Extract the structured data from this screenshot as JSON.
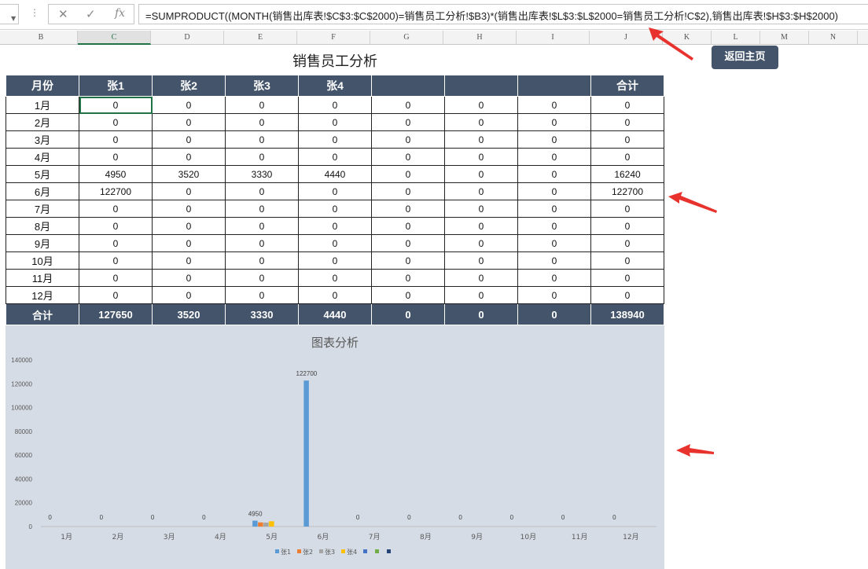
{
  "formula_bar": {
    "formula": "=SUMPRODUCT((MONTH(销售出库表!$C$3:$C$2000)=销售员工分析!$B3)*(销售出库表!$L$3:$L$2000=销售员工分析!C$2),销售出库表!$H$3:$H$2000)"
  },
  "columns": [
    "B",
    "C",
    "D",
    "E",
    "F",
    "G",
    "H",
    "I",
    "J",
    "K",
    "L",
    "M",
    "N"
  ],
  "selected_column": "C",
  "sheet_title": "销售员工分析",
  "home_button": "返回主页",
  "table": {
    "headers": [
      "月份",
      "张1",
      "张2",
      "张3",
      "张4",
      "",
      "",
      "",
      "合计"
    ],
    "rows": [
      {
        "month": "1月",
        "values": [
          "0",
          "0",
          "0",
          "0",
          "0",
          "0",
          "0",
          "0"
        ]
      },
      {
        "month": "2月",
        "values": [
          "0",
          "0",
          "0",
          "0",
          "0",
          "0",
          "0",
          "0"
        ]
      },
      {
        "month": "3月",
        "values": [
          "0",
          "0",
          "0",
          "0",
          "0",
          "0",
          "0",
          "0"
        ]
      },
      {
        "month": "4月",
        "values": [
          "0",
          "0",
          "0",
          "0",
          "0",
          "0",
          "0",
          "0"
        ]
      },
      {
        "month": "5月",
        "values": [
          "4950",
          "3520",
          "3330",
          "4440",
          "0",
          "0",
          "0",
          "16240"
        ]
      },
      {
        "month": "6月",
        "values": [
          "122700",
          "0",
          "0",
          "0",
          "0",
          "0",
          "0",
          "122700"
        ]
      },
      {
        "month": "7月",
        "values": [
          "0",
          "0",
          "0",
          "0",
          "0",
          "0",
          "0",
          "0"
        ]
      },
      {
        "month": "8月",
        "values": [
          "0",
          "0",
          "0",
          "0",
          "0",
          "0",
          "0",
          "0"
        ]
      },
      {
        "month": "9月",
        "values": [
          "0",
          "0",
          "0",
          "0",
          "0",
          "0",
          "0",
          "0"
        ]
      },
      {
        "month": "10月",
        "values": [
          "0",
          "0",
          "0",
          "0",
          "0",
          "0",
          "0",
          "0"
        ]
      },
      {
        "month": "11月",
        "values": [
          "0",
          "0",
          "0",
          "0",
          "0",
          "0",
          "0",
          "0"
        ]
      },
      {
        "month": "12月",
        "values": [
          "0",
          "0",
          "0",
          "0",
          "0",
          "0",
          "0",
          "0"
        ]
      }
    ],
    "total": {
      "label": "合计",
      "values": [
        "127650",
        "3520",
        "3330",
        "4440",
        "0",
        "0",
        "0",
        "138940"
      ]
    }
  },
  "chart_data": {
    "type": "bar",
    "title": "图表分析",
    "categories": [
      "1月",
      "2月",
      "3月",
      "4月",
      "5月",
      "6月",
      "7月",
      "8月",
      "9月",
      "10月",
      "11月",
      "12月"
    ],
    "ylim": [
      0,
      140000
    ],
    "yticks": [
      "0",
      "20000",
      "40000",
      "60000",
      "80000",
      "100000",
      "120000",
      "140000"
    ],
    "series": [
      {
        "name": "张1",
        "color": "#5b9bd5",
        "values": [
          0,
          0,
          0,
          0,
          4950,
          122700,
          0,
          0,
          0,
          0,
          0,
          0
        ]
      },
      {
        "name": "张2",
        "color": "#ed7d31",
        "values": [
          0,
          0,
          0,
          0,
          3520,
          0,
          0,
          0,
          0,
          0,
          0,
          0
        ]
      },
      {
        "name": "张3",
        "color": "#a5a5a5",
        "values": [
          0,
          0,
          0,
          0,
          3330,
          0,
          0,
          0,
          0,
          0,
          0,
          0
        ]
      },
      {
        "name": "张4",
        "color": "#ffc000",
        "values": [
          0,
          0,
          0,
          0,
          4440,
          0,
          0,
          0,
          0,
          0,
          0,
          0
        ]
      },
      {
        "name": "",
        "color": "#4472c4",
        "values": [
          0,
          0,
          0,
          0,
          0,
          0,
          0,
          0,
          0,
          0,
          0,
          0
        ]
      },
      {
        "name": "",
        "color": "#70ad47",
        "values": [
          0,
          0,
          0,
          0,
          0,
          0,
          0,
          0,
          0,
          0,
          0,
          0
        ]
      },
      {
        "name": "",
        "color": "#264478",
        "values": [
          0,
          0,
          0,
          0,
          0,
          0,
          0,
          0,
          0,
          0,
          0,
          0
        ]
      }
    ],
    "data_labels": [
      "0",
      "0",
      "0",
      "0",
      "4950",
      "122700",
      "0",
      "0",
      "0",
      "0",
      "0",
      "0"
    ],
    "grid": false,
    "legend": "bottom"
  },
  "colors": {
    "header_bg": "#44546a",
    "chart_bg": "#d6dce5",
    "selection": "#217346",
    "arrow": "#e8322d"
  }
}
